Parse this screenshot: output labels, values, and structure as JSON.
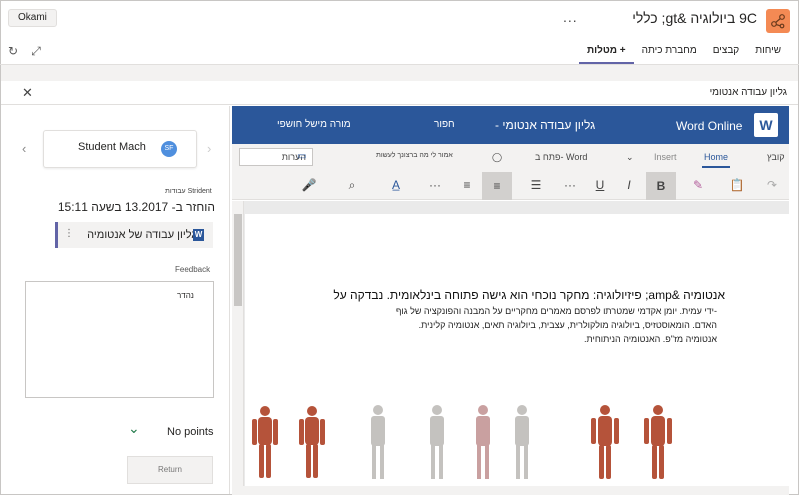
{
  "app": {
    "context_button": "Okami",
    "team_title": "9C ביולוגיה &gt; כללי",
    "more_label": "..."
  },
  "tabs": [
    "שיחות",
    "קבצים",
    "מחברת כיתה",
    "מטלות +"
  ],
  "assignment": {
    "title": "גליון עבודה אנטומי"
  },
  "student_panel": {
    "student_name": "Student Mach",
    "avatar_initials": "SF",
    "section_label": "עבודות Strident",
    "returned_text": "הוחזר ב- 13.2017 בשעה 15:11",
    "file_name": "גליון עבודה של אנטומיה",
    "file_icon_letter": "W",
    "feedback_label": "Feedback",
    "feedback_text": "נהדר",
    "points_label": "No points",
    "return_button": "Return"
  },
  "word": {
    "logo_letter": "W",
    "product_name": "Word Online",
    "doc_title": "גליון עבודה אנטומי -",
    "save_status": "חפור",
    "user_name": "מורה מישל חושפי",
    "ribbon_tabs": [
      "קובץ",
      "Home",
      "Insert",
      "פתח ב- Word"
    ],
    "tell_me": "אמור לי מה ברצונך לעשות",
    "comments_label": "הערות",
    "toolbar_icons": [
      "undo-icon",
      "paste-icon",
      "format-painter-icon",
      "bold-icon",
      "italic-icon",
      "underline-icon",
      "more-icon",
      "bullets-icon",
      "align-right-icon",
      "align-center-icon",
      "more-icon",
      "font-color-icon",
      "find-icon",
      "dictate-icon"
    ],
    "bold_label": "B",
    "italic_label": "I",
    "underline_label": "U"
  },
  "document": {
    "heading": "אנטומיה &amp; פיזיולוגיה: מחקר נוכחי הוא גישה פתוחה בינלאומית. נבדקה על",
    "lines": [
      "-ידי עמית. יומן אקדמי שמטרתו לפרסם מאמרים מחקריים על המבנה והפונקציה של גוף",
      "האדם. הומאוסטזיס, ביולוגיה מולקולרית, עצבית, ביולוגיה תאים, אנטומיה קלינית.",
      "אנטומיה מז\"פ. האנטומיה הניתוחית."
    ]
  },
  "colors": {
    "word_blue": "#2b579a",
    "teams_purple": "#6264a7",
    "team_icon": "#f48a54",
    "points_green": "#237b4b"
  }
}
